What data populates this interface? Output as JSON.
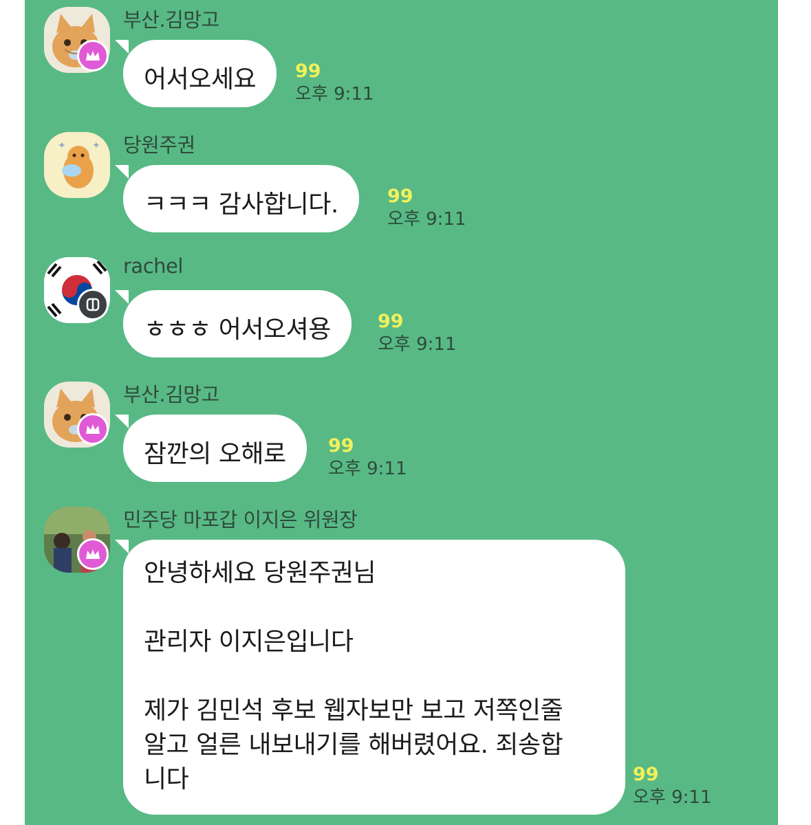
{
  "messages": [
    {
      "sender": "부산.김망고",
      "avatar": "cat-avatar",
      "badge": "crown-icon",
      "text": "어서오세요",
      "unread": "99",
      "time": "오후 9:11"
    },
    {
      "sender": "당원주권",
      "avatar": "hamster-avatar",
      "badge": null,
      "text": "ㅋㅋㅋ 감사합니다.",
      "unread": "99",
      "time": "오후 9:11"
    },
    {
      "sender": "rachel",
      "avatar": "korean-flag-avatar",
      "badge": "channel-icon",
      "text": "ㅎㅎㅎ 어서오셔용",
      "unread": "99",
      "time": "오후 9:11"
    },
    {
      "sender": "부산.김망고",
      "avatar": "cat-avatar",
      "badge": "crown-icon",
      "text": "잠깐의 오해로",
      "unread": "99",
      "time": "오후 9:11"
    },
    {
      "sender": "민주당 마포갑 이지은 위원장",
      "avatar": "photo-avatar",
      "badge": "crown-icon",
      "lines": [
        "안녕하세요 당원주권님",
        "관리자 이지은입니다",
        "제가 김민석 후보 웹자보만 보고 저쪽인줄",
        "알고 얼른 내보내기를 해버렸어요. 죄송합",
        "니다"
      ],
      "unread": "99",
      "time": "오후 9:11"
    }
  ],
  "colors": {
    "chat_bg": "#58b985",
    "bubble": "#ffffff",
    "unread": "#f2f05b",
    "crown_badge": "#e05ad6"
  }
}
